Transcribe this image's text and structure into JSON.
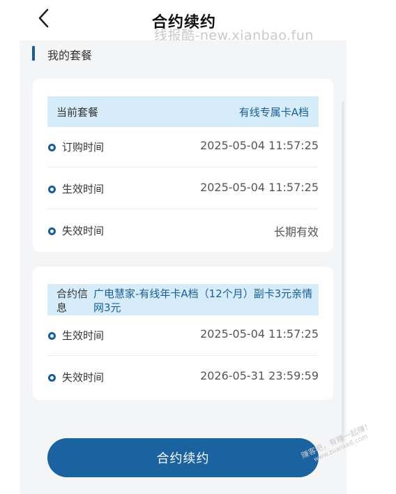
{
  "header": {
    "back_icon": "chevron-left-icon",
    "title": "合约续约",
    "watermark": "线报酷-new.xianbao.fun"
  },
  "section": {
    "title": "我的套餐"
  },
  "current_plan": {
    "label": "当前套餐",
    "value": "有线专属卡A档",
    "rows": [
      {
        "label": "订购时间",
        "value": "2025-05-04 11:57:25"
      },
      {
        "label": "生效时间",
        "value": "2025-05-04 11:57:25"
      },
      {
        "label": "失效时间",
        "value": "长期有效"
      }
    ]
  },
  "contract": {
    "label": "合约信息",
    "value": "广电慧家-有线年卡A档（12个月）副卡3元亲情网3元",
    "rows": [
      {
        "label": "生效时间",
        "value": "2025-05-04 11:57:25"
      },
      {
        "label": "失效时间",
        "value": "2026-05-31 23:59:59"
      }
    ]
  },
  "action": {
    "renew_label": "合约续约"
  },
  "corner_watermark": {
    "line1": "赚客吧，有赚一起赚！",
    "line2": "www.zuanke8.com"
  },
  "colors": {
    "accent": "#1a5d96",
    "highlight_bg": "#d6ecfa",
    "button_bg": "#1a63a0",
    "panel_bg": "#f4f5f7"
  }
}
